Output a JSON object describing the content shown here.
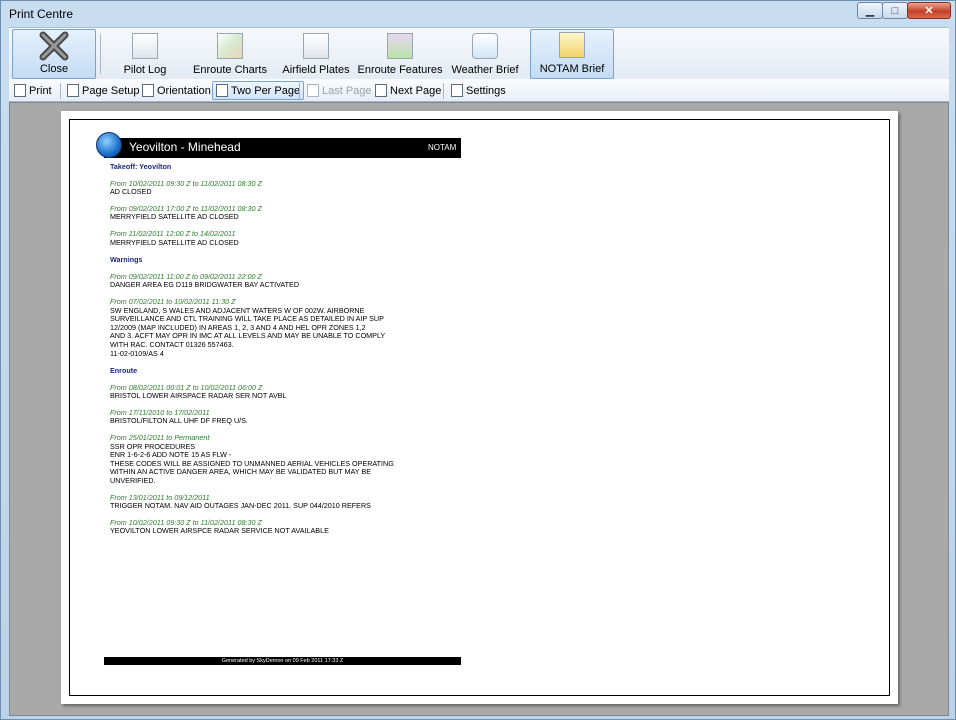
{
  "window": {
    "title": "Print Centre"
  },
  "window_buttons": {
    "minimize": "▁",
    "maximize": "□",
    "close": "✕"
  },
  "ribbon": [
    {
      "label": "Close",
      "icon": "close-icon"
    },
    {
      "label": "Pilot Log",
      "icon": "pilot-log-icon"
    },
    {
      "label": "Enroute Charts",
      "icon": "enroute-charts-icon"
    },
    {
      "label": "Airfield Plates",
      "icon": "airfield-plates-icon"
    },
    {
      "label": "Enroute Features",
      "icon": "enroute-features-icon"
    },
    {
      "label": "Weather Brief",
      "icon": "weather-brief-icon"
    },
    {
      "label": "NOTAM Brief",
      "icon": "notam-brief-icon"
    }
  ],
  "toolbar": [
    {
      "label": "Print",
      "icon": "printer-icon"
    },
    {
      "label": "Page Setup",
      "icon": "page-setup-icon"
    },
    {
      "label": "Orientation",
      "icon": "orientation-icon"
    },
    {
      "label": "Two Per Page",
      "icon": "two-per-page-icon"
    },
    {
      "label": "Last Page",
      "icon": "last-page-icon"
    },
    {
      "label": "Next Page",
      "icon": "next-page-icon"
    },
    {
      "label": "Settings",
      "icon": "settings-icon"
    }
  ],
  "document": {
    "route": "Yeovilton - Minehead",
    "type": "NOTAM",
    "footer": "Generated by SkyDemon on 09 Feb 2011 17:33 Z",
    "sections": [
      {
        "title": "Takeoff: Yeovilton",
        "items": [
          {
            "date": "From 10/02/2011 09:30 Z to 11/02/2011 08:30 Z",
            "text": "AD CLOSED"
          },
          {
            "date": "From 09/02/2011 17:00 Z to 11/02/2011 08:30 Z",
            "text": "MERRYFIELD SATELLITE AD CLOSED"
          },
          {
            "date": "From 11/02/2011 12:00 Z to 14/02/2011",
            "text": "MERRYFIELD SATELLITE AD CLOSED"
          }
        ]
      },
      {
        "title": "Warnings",
        "items": [
          {
            "date": "From 09/02/2011 11:00 Z to 09/02/2011 22:00 Z",
            "text": "DANGER AREA EG D119 BRIDGWATER BAY ACTIVATED"
          },
          {
            "date": "From 07/02/2011 to 10/02/2011 11:30 Z",
            "text": "SW ENGLAND, S WALES AND ADJACENT WATERS W OF 002W. AIRBORNE\nSURVEILLANCE AND CTL TRAINING WILL TAKE PLACE AS DETAILED IN AIP SUP\n12/2009 (MAP INCLUDED) IN AREAS 1, 2, 3 AND 4 AND HEL OPR ZONES 1,2\nAND 3. ACFT MAY OPR IN IMC AT ALL LEVELS AND MAY BE UNABLE TO COMPLY\nWITH RAC. CONTACT 01326 557463.\n11-02-0109/AS 4"
          }
        ]
      },
      {
        "title": "Enroute",
        "items": [
          {
            "date": "From 08/02/2011 00:01 Z to 10/02/2011 06:00 Z",
            "text": "BRISTOL LOWER AIRSPACE RADAR SER NOT AVBL"
          },
          {
            "date": "From 17/11/2010 to 17/02/2011",
            "text": "BRISTOL/FILTON ALL UHF DF FREQ U/S."
          },
          {
            "date": "From 25/01/2011 to Permanent",
            "text": "SSR OPR PROCEDURES\nENR 1-6-2-6 ADD NOTE 15 AS FLW -\nTHESE CODES WILL BE ASSIGNED TO UNMANNED AERIAL VEHICLES OPERATING\nWITHIN AN ACTIVE DANGER AREA, WHICH MAY BE VALIDATED BUT MAY BE\nUNVERIFIED."
          },
          {
            "date": "From 13/01/2011 to 09/12/2011",
            "text": "TRIGGER NOTAM. NAV AID OUTAGES JAN-DEC 2011. SUP 044/2010 REFERS"
          },
          {
            "date": "From 10/02/2011 09:30 Z to 11/02/2011 08:30 Z",
            "text": "YEOVILTON LOWER AIRSPCE RADAR SERVICE NOT AVAILABLE"
          }
        ]
      }
    ]
  }
}
